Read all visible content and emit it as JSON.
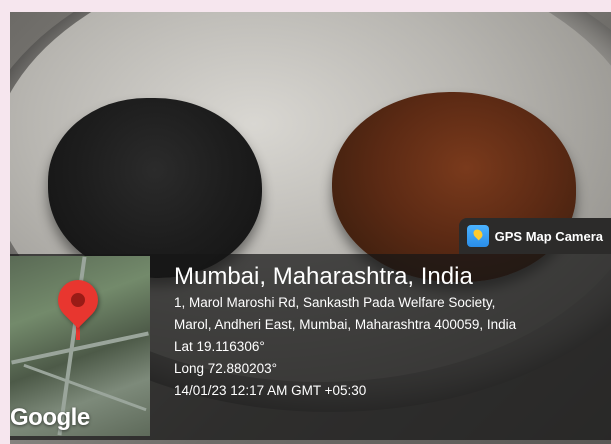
{
  "overlay": {
    "app_label": "GPS Map Camera",
    "city": "Mumbai, Maharashtra, India",
    "address_line_1": "1, Marol Maroshi Rd, Sankasth Pada Welfare Society,",
    "address_line_2": "Marol, Andheri East, Mumbai, Maharashtra 400059, India",
    "latitude": "Lat 19.116306°",
    "longitude": "Long 72.880203°",
    "timestamp": "14/01/23 12:17 AM GMT +05:30",
    "map_logo": "Google"
  },
  "icons": {
    "app_icon": "gps-map-camera-icon",
    "map_pin": "map-pin-icon"
  },
  "colors": {
    "pin": "#e8362f",
    "panel": "#161616",
    "text": "#ffffff"
  }
}
